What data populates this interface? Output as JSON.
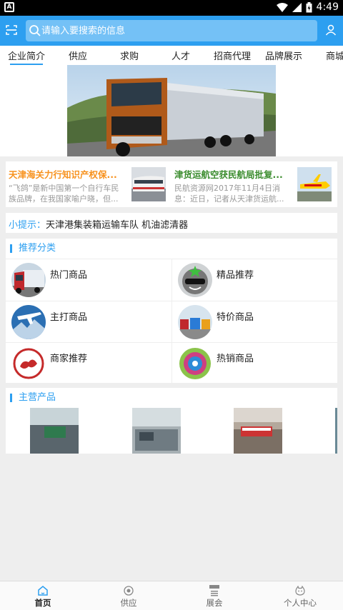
{
  "status_bar": {
    "time": "4:49",
    "left_badge": "A"
  },
  "search": {
    "placeholder": "请输入要搜索的信息"
  },
  "tabs": [
    {
      "label": "企业简介"
    },
    {
      "label": "供应"
    },
    {
      "label": "求购"
    },
    {
      "label": "人才"
    },
    {
      "label": "招商代理"
    },
    {
      "label": "品牌展示"
    },
    {
      "label": "商城"
    }
  ],
  "news": [
    {
      "title": "天津海关力行知识产权保...",
      "desc": "“飞鸽”是新中国第一个自行车民族品牌，在我国家喻户晓，但...",
      "title_color": "#f7921e"
    },
    {
      "title": "津货运航空获民航局批复...",
      "desc": "民航资源网2017年11月4日消息：近日，记者从天津货运航...",
      "title_color": "#3c8d2f"
    }
  ],
  "tip": {
    "label": "小提示：",
    "text": "天津港集装箱运输车队 机油滤清器"
  },
  "recommend": {
    "title": "推荐分类",
    "items": [
      {
        "label": "热门商品",
        "icon": "truck-icon"
      },
      {
        "label": "精品推荐",
        "icon": "star-face-icon"
      },
      {
        "label": "主打商品",
        "icon": "plane-icon"
      },
      {
        "label": "特价商品",
        "icon": "trucks-icon"
      },
      {
        "label": "商家推荐",
        "icon": "cloud-emblem-icon"
      },
      {
        "label": "热销商品",
        "icon": "rings-icon"
      }
    ]
  },
  "main_products": {
    "title": "主营产品"
  },
  "bottom_nav": [
    {
      "label": "首页"
    },
    {
      "label": "供应"
    },
    {
      "label": "展会"
    },
    {
      "label": "个人中心"
    }
  ],
  "colors": {
    "primary": "#2d9ff0",
    "search_bg": "#74c1f6"
  }
}
